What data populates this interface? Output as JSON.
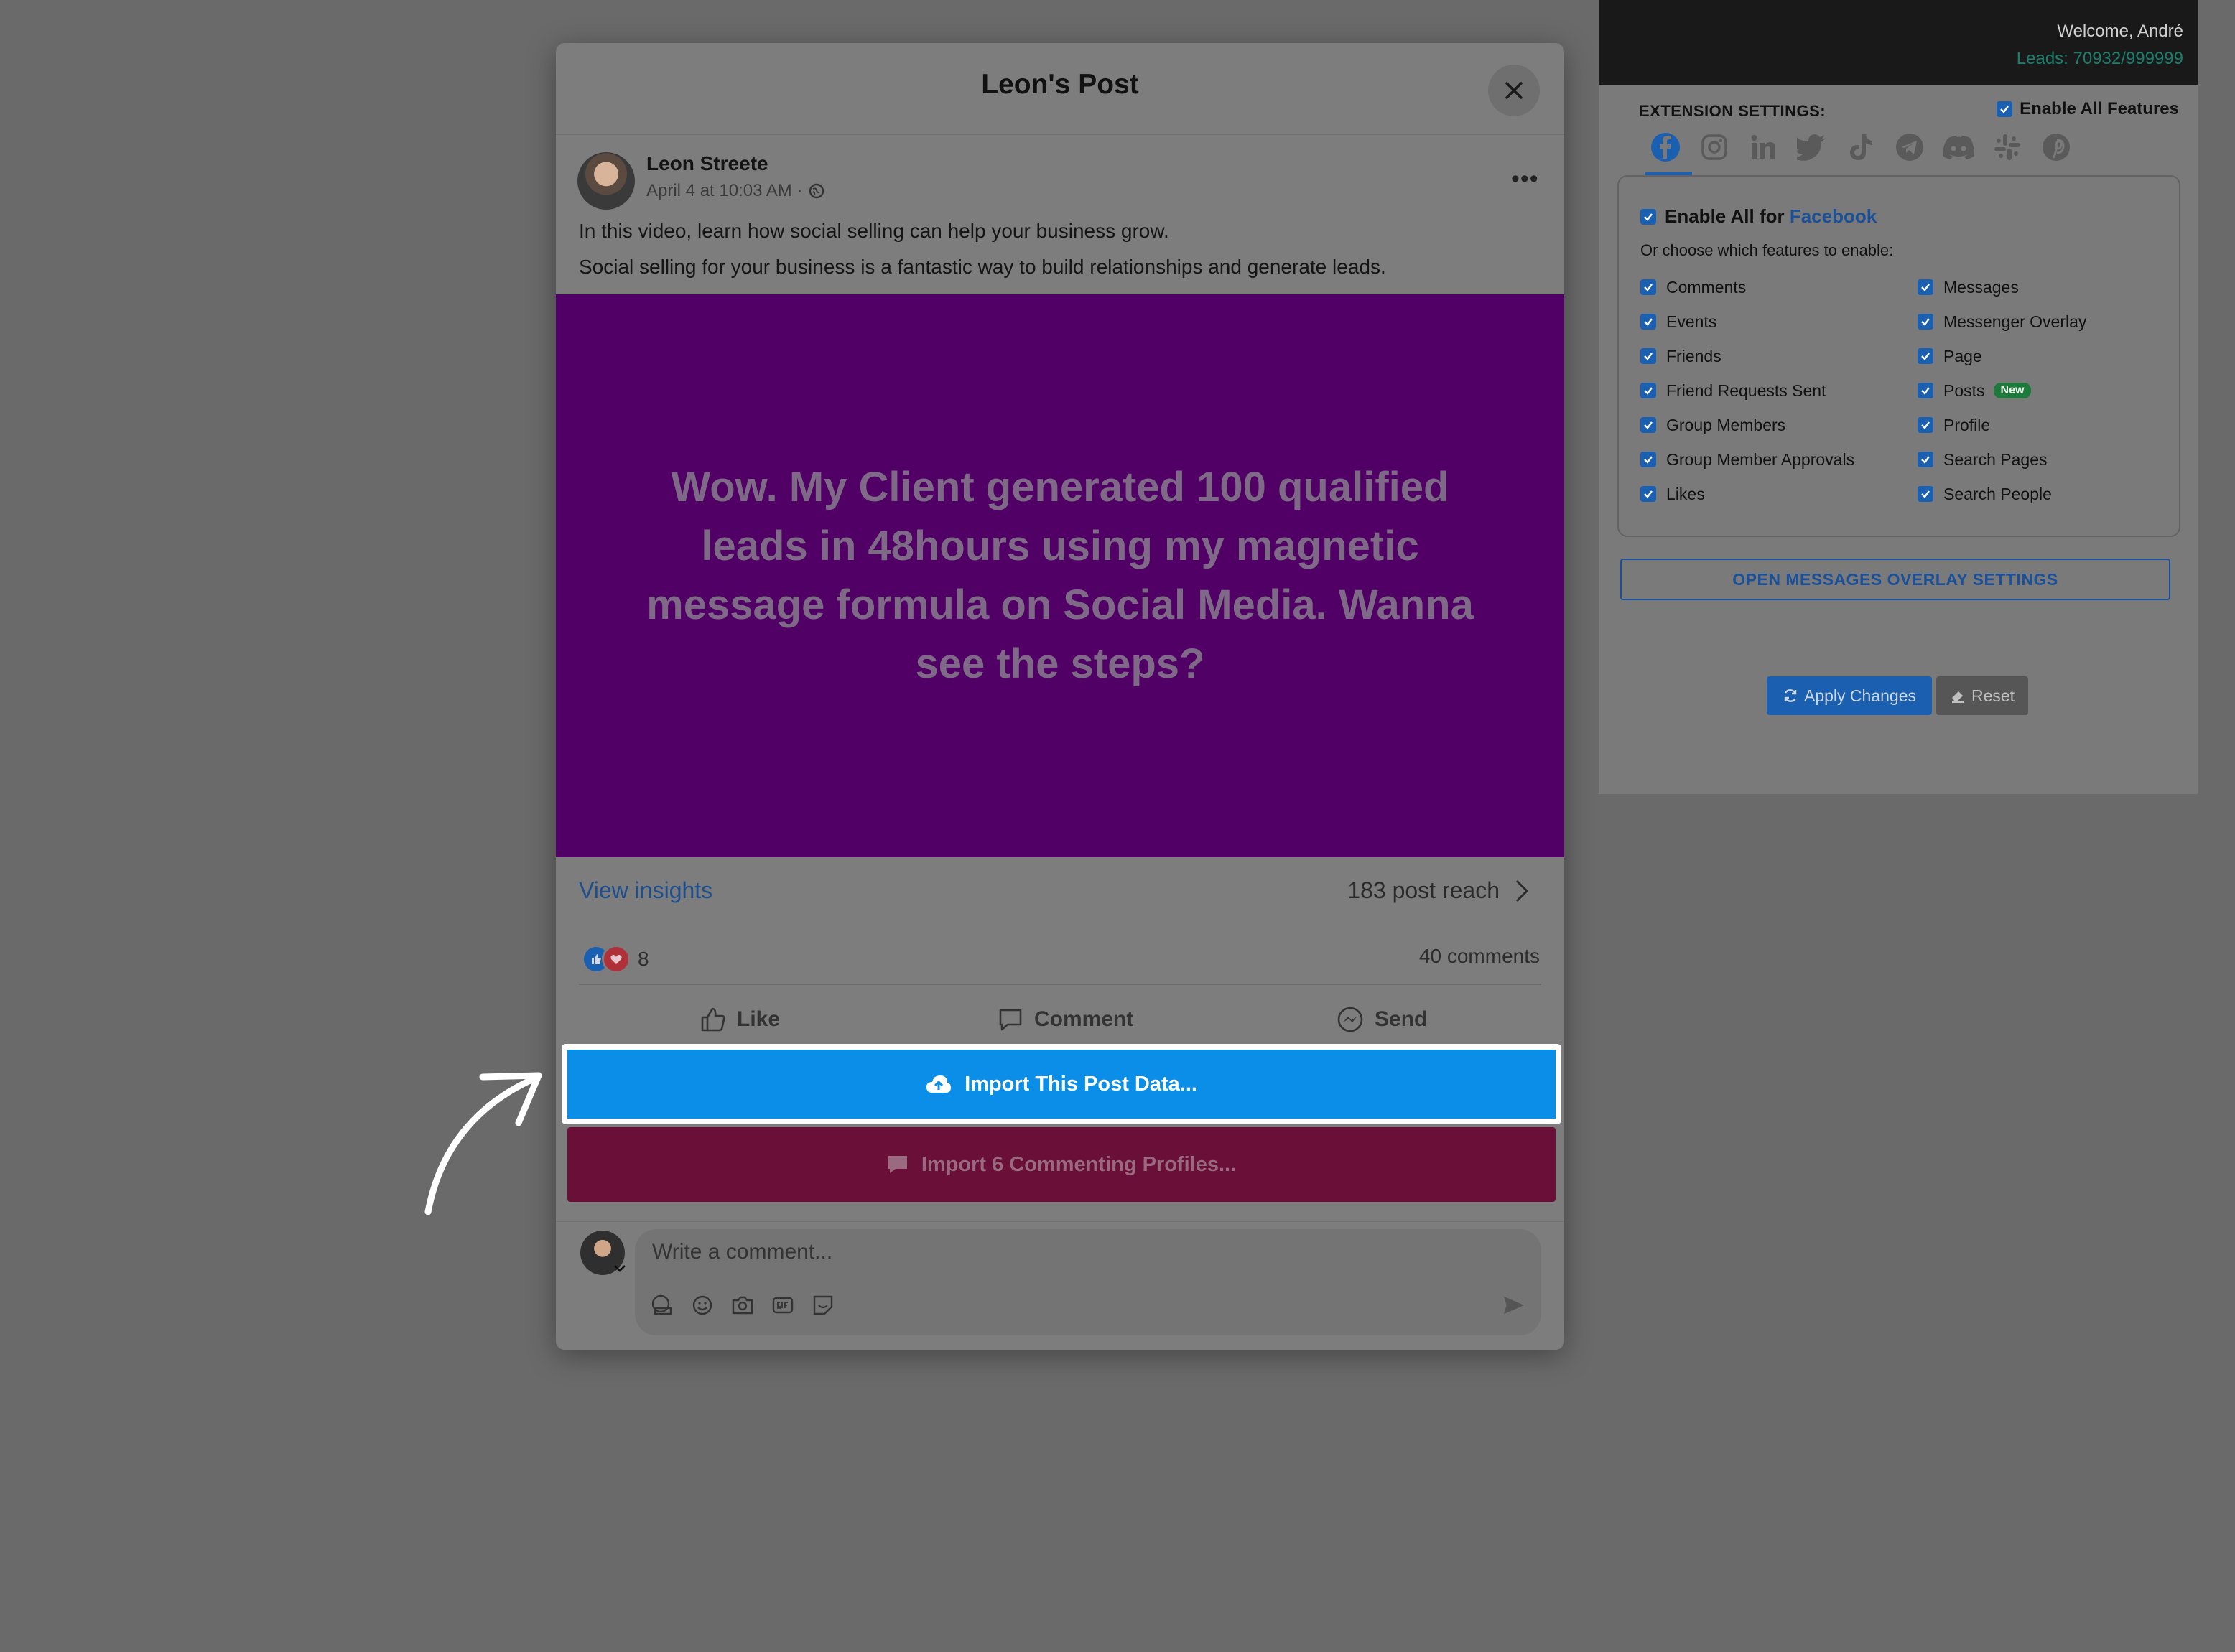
{
  "post_modal": {
    "title": "Leon's Post",
    "author_name": "Leon Streete",
    "post_meta": "April 4 at 10:03 AM ·",
    "caption_line1": "In this video, learn how social selling can help your business grow.",
    "caption_line2": "Social selling for your business is a fantastic way to build relationships and generate leads.",
    "media_text": "Wow. My Client generated 100 qualified leads in 48hours using my magnetic message formula on Social Media. Wanna see the steps?",
    "view_insights": "View insights",
    "post_reach": "183 post reach",
    "reaction_count": "8",
    "comments_count": "40 comments",
    "actions": {
      "like": "Like",
      "comment": "Comment",
      "send": "Send"
    },
    "import_post_label": "Import This Post Data...",
    "import_comments_label": "Import 6 Commenting Profiles...",
    "comment_placeholder": "Write a comment..."
  },
  "extension": {
    "welcome": "Welcome, André",
    "leads": "Leads: 70932/999999",
    "settings_label": "EXTENSION SETTINGS:",
    "enable_all_features": "Enable All Features",
    "platform_tabs": [
      "facebook-icon",
      "instagram-icon",
      "linkedin-icon",
      "twitter-icon",
      "tiktok-icon",
      "telegram-icon",
      "discord-icon",
      "slack-icon",
      "pinterest-icon"
    ],
    "enable_all_for": "Enable All for",
    "platform_name": "Facebook",
    "choose_label": "Or choose which features to enable:",
    "features_left": [
      "Comments",
      "Events",
      "Friends",
      "Friend Requests Sent",
      "Group Members",
      "Group Member Approvals",
      "Likes"
    ],
    "features_right": [
      "Messages",
      "Messenger Overlay",
      "Page",
      "Posts",
      "Profile",
      "Search Pages",
      "Search People"
    ],
    "new_badge": "New",
    "overlay_settings_button": "OPEN MESSAGES OVERLAY SETTINGS",
    "apply_button": "Apply Changes",
    "reset_button": "Reset"
  },
  "colors": {
    "import_post": "#0b8ee8",
    "import_comments": "#6a0f38",
    "media_bg": "#510066",
    "extension_accent": "#1b5fb0",
    "new_badge": "#1d7a3a"
  }
}
